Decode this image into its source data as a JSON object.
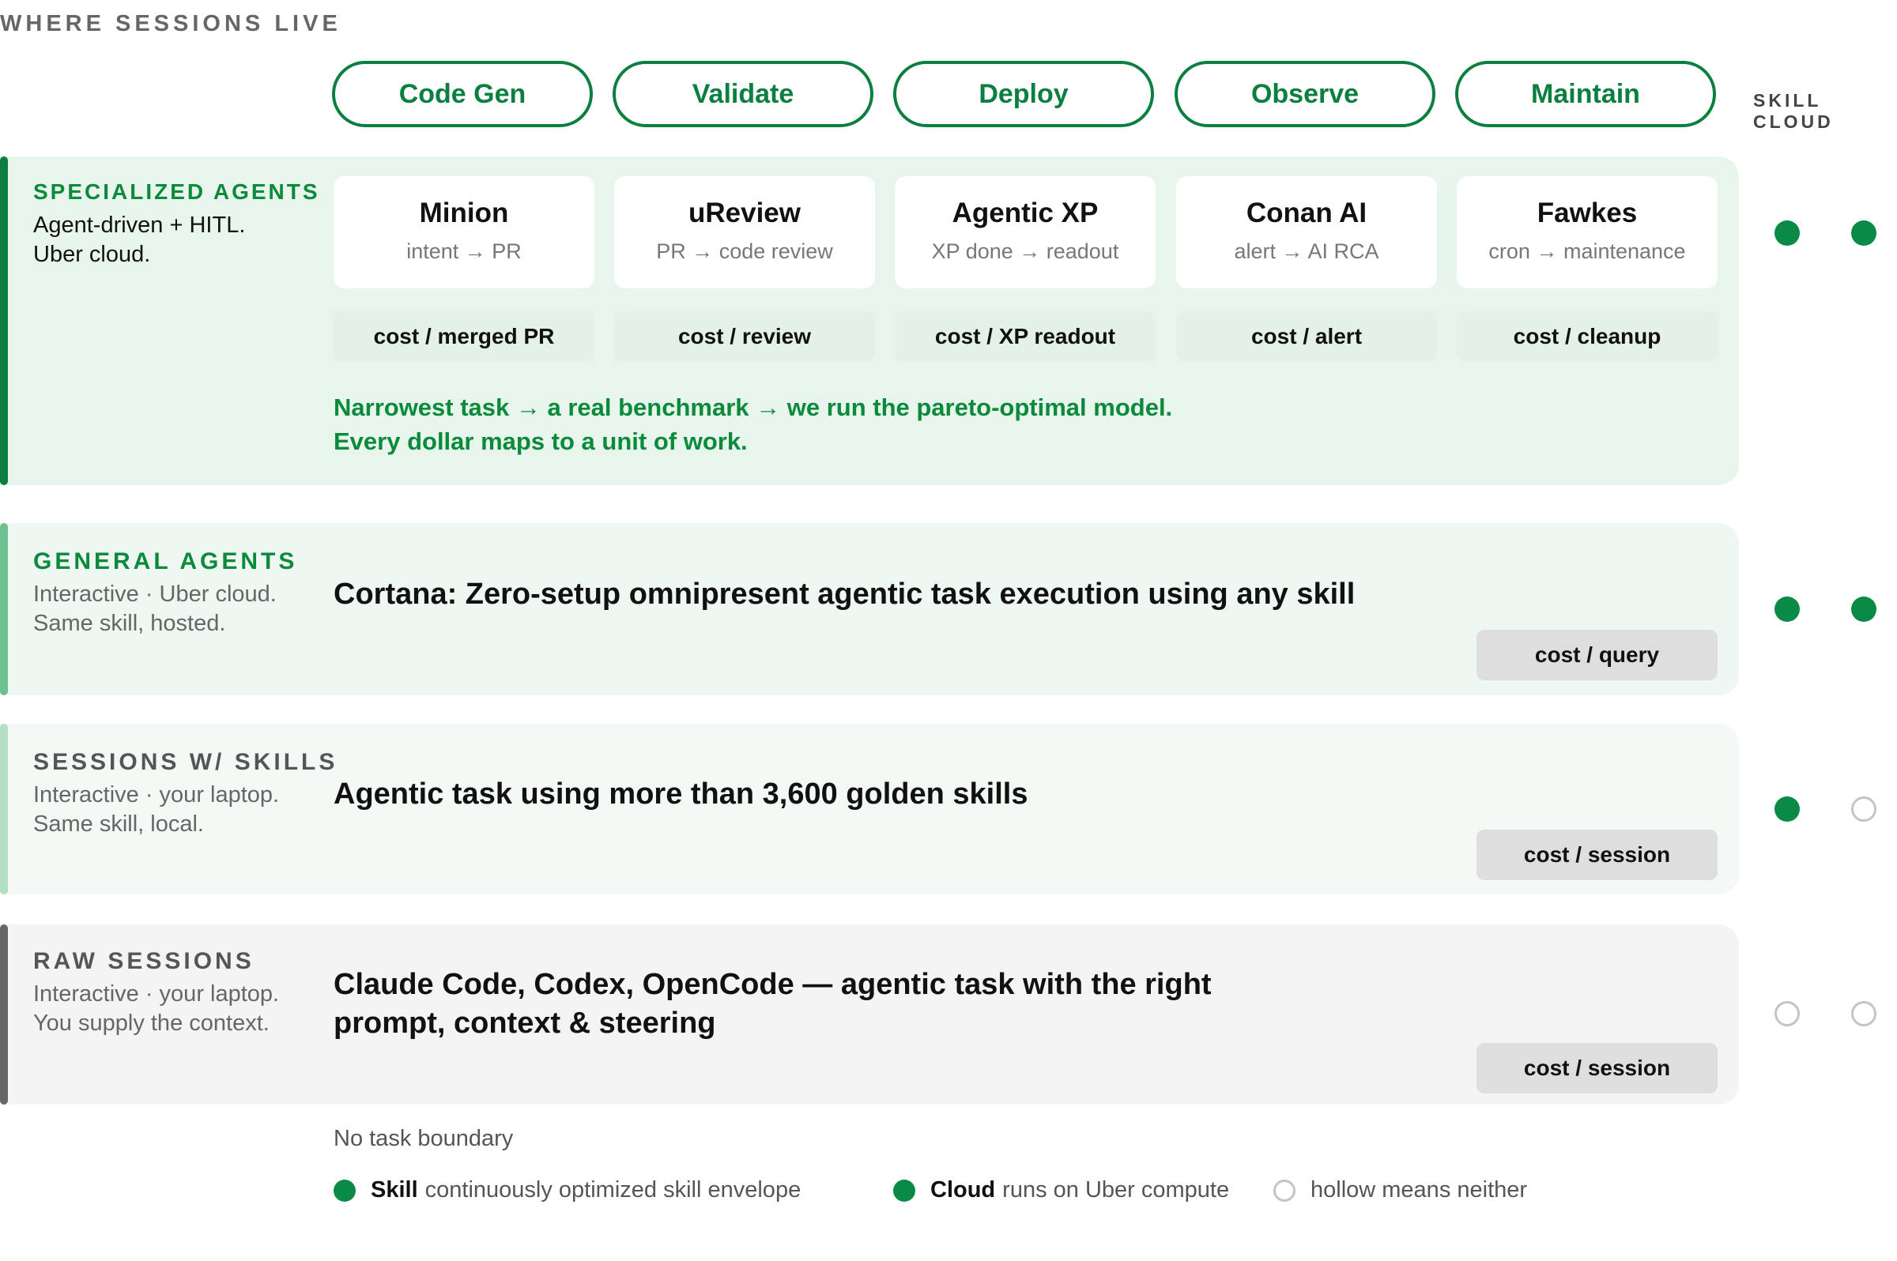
{
  "header": {
    "eyebrow": "WHERE SESSIONS LIVE",
    "col_label": "SKILL CLOUD"
  },
  "stages": [
    "Code Gen",
    "Validate",
    "Deploy",
    "Observe",
    "Maintain"
  ],
  "specialized": {
    "title": "SPECIALIZED AGENTS",
    "desc": "Agent-driven + HITL.\nUber cloud.",
    "agents": [
      {
        "name": "Minion",
        "flow": "intent → PR",
        "cost": "cost / merged PR"
      },
      {
        "name": "uReview",
        "flow": "PR → code review",
        "cost": "cost / review"
      },
      {
        "name": "Agentic XP",
        "flow": "XP done → readout",
        "cost": "cost / XP readout"
      },
      {
        "name": "Conan AI",
        "flow": "alert → AI RCA",
        "cost": "cost / alert"
      },
      {
        "name": "Fawkes",
        "flow": "cron → maintenance",
        "cost": "cost / cleanup"
      }
    ],
    "note": "Narrowest task → a real benchmark → we run the pareto-optimal model.\nEvery dollar maps to a unit of work.",
    "skill": true,
    "cloud": true
  },
  "general": {
    "title": "GENERAL AGENTS",
    "desc": "Interactive · Uber cloud.\nSame skill, hosted.",
    "headline": "Cortana: Zero-setup omnipresent agentic task execution using any skill",
    "cost": "cost / query",
    "skill": true,
    "cloud": true
  },
  "skills": {
    "title": "SESSIONS W/ SKILLS",
    "desc": "Interactive · your laptop.\nSame skill, local.",
    "headline": "Agentic task using more than 3,600 golden skills",
    "cost": "cost / session",
    "skill": true,
    "cloud": false
  },
  "raw": {
    "title": "RAW SESSIONS",
    "desc": "Interactive · your laptop.\nYou supply the context.",
    "headline_line1": "Claude Code, Codex, OpenCode — agentic task with the right",
    "headline_line2": "prompt, context & steering",
    "cost": "cost / session",
    "skill": false,
    "cloud": false
  },
  "footer": {
    "boundary": "No task boundary",
    "legend": [
      {
        "bold": "Skill",
        "text": "continuously optimized skill envelope",
        "icon": "filled-dot"
      },
      {
        "bold": "Cloud",
        "text": "runs on Uber compute",
        "icon": "filled-dot"
      },
      {
        "bold": "",
        "text": "hollow means neither",
        "icon": "hollow-dot"
      }
    ]
  },
  "colors": {
    "accent_green": "#0a7f3f",
    "specialized_bg": "#e8f5ec",
    "general_bg": "#eef7f1",
    "skills_bg": "#f4f9f6",
    "raw_bg": "#f4f4f4"
  }
}
